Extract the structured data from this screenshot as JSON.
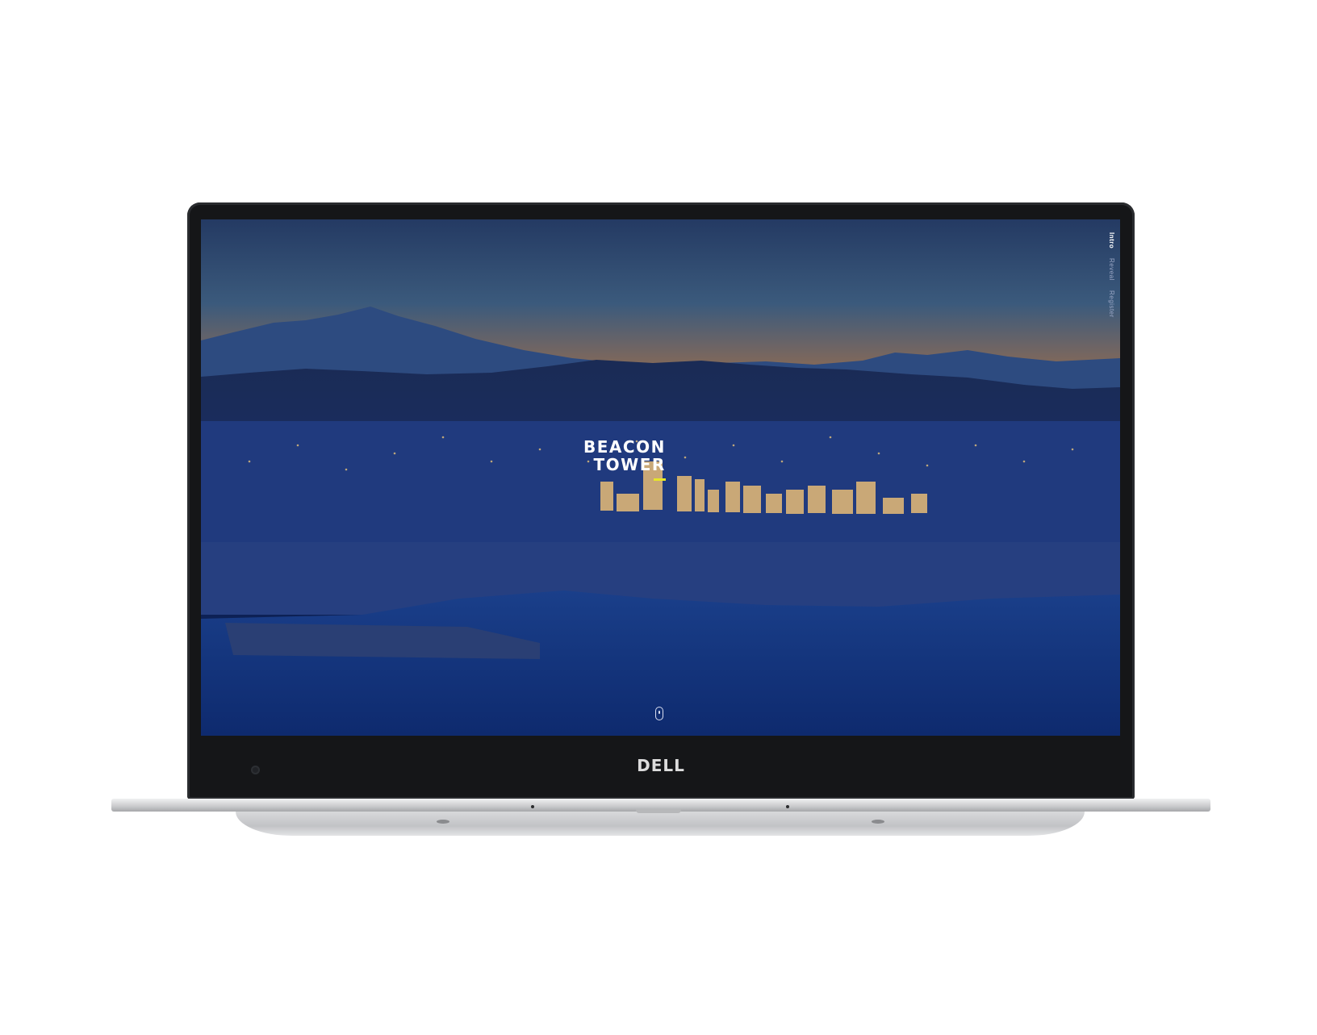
{
  "device": {
    "brand": "DELL"
  },
  "website": {
    "logo_line1": "BEACON",
    "logo_line2": "TOWER",
    "accent_color": "#e6e628",
    "nav": [
      {
        "label": "Intro",
        "active": true
      },
      {
        "label": "Reveal",
        "active": false
      },
      {
        "label": "Register",
        "active": false
      }
    ],
    "background": "night-city-skyline-image",
    "scroll_icon": "mouse-scroll-icon"
  }
}
